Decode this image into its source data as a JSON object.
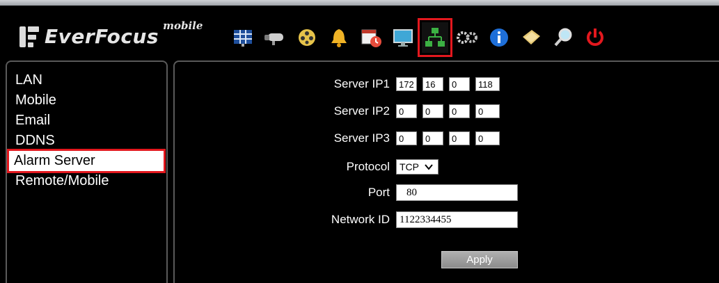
{
  "header": {
    "logo_text": "EverFocus",
    "logo_suffix": "mobile"
  },
  "toolbar": {
    "icons": [
      {
        "name": "grid-layout-icon"
      },
      {
        "name": "camera-icon"
      },
      {
        "name": "film-reel-icon"
      },
      {
        "name": "alarm-bell-icon"
      },
      {
        "name": "schedule-calendar-icon"
      },
      {
        "name": "monitor-icon"
      },
      {
        "name": "network-icon",
        "active": true
      },
      {
        "name": "gears-icon"
      },
      {
        "name": "info-icon"
      },
      {
        "name": "folder-icon"
      },
      {
        "name": "magnifier-icon"
      },
      {
        "name": "power-icon"
      }
    ]
  },
  "sidebar": {
    "items": [
      {
        "label": "LAN"
      },
      {
        "label": "Mobile"
      },
      {
        "label": "Email"
      },
      {
        "label": "DDNS"
      },
      {
        "label": "Alarm Server",
        "selected": true
      },
      {
        "label": "Remote/Mobile"
      }
    ]
  },
  "form": {
    "server_ip1_label": "Server IP1",
    "server_ip1": [
      "172",
      "16",
      "0",
      "118"
    ],
    "server_ip2_label": "Server IP2",
    "server_ip2": [
      "0",
      "0",
      "0",
      "0"
    ],
    "server_ip3_label": "Server IP3",
    "server_ip3": [
      "0",
      "0",
      "0",
      "0"
    ],
    "protocol_label": "Protocol",
    "protocol_value": "TCP",
    "port_label": "Port",
    "port_value": "80",
    "network_id_label": "Network ID",
    "network_id_value": "1122334455",
    "apply_label": "Apply"
  },
  "colors": {
    "highlight_border": "#e3181e",
    "background": "#000000",
    "panel_border": "#5a5a5a"
  }
}
